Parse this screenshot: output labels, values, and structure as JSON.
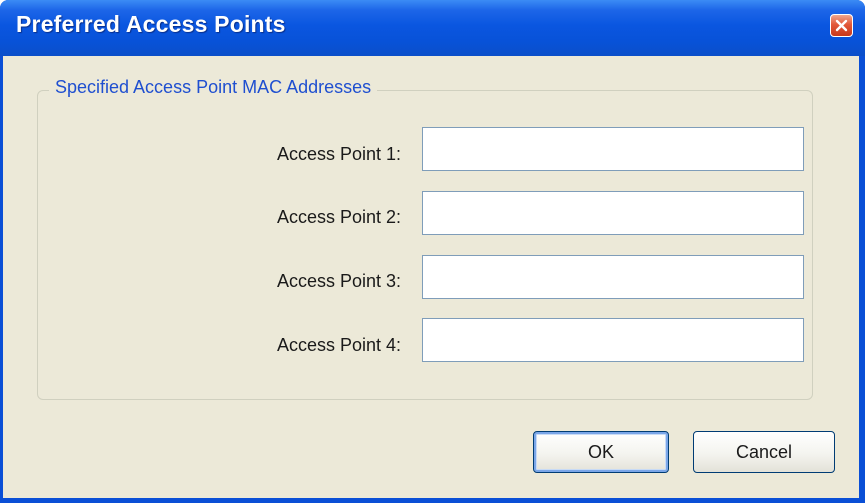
{
  "window": {
    "title": "Preferred Access Points",
    "close_icon": "close-icon"
  },
  "group": {
    "legend": "Specified Access Point MAC Addresses"
  },
  "access_points": [
    {
      "label": "Access Point 1:",
      "value": ""
    },
    {
      "label": "Access Point 2:",
      "value": ""
    },
    {
      "label": "Access Point 3:",
      "value": ""
    },
    {
      "label": "Access Point 4:",
      "value": ""
    }
  ],
  "buttons": {
    "ok_label": "OK",
    "cancel_label": "Cancel"
  },
  "colors": {
    "titlebar": "#0852d8",
    "client_bg": "#ece9d8",
    "legend_text": "#1f4fd0",
    "close_button": "#e2593a"
  }
}
